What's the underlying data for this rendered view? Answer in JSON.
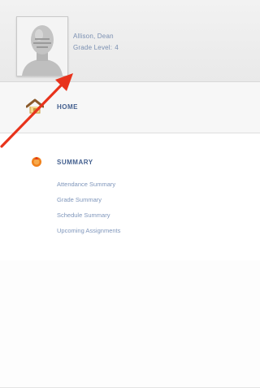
{
  "profile": {
    "name": "Allison, Dean",
    "grade_label": "Grade Level:",
    "grade_value": "4",
    "avatar_icon": "user-silhouette-icon"
  },
  "nav": {
    "home": {
      "label": "HOME",
      "icon": "home-icon"
    },
    "summary": {
      "label": "SUMMARY",
      "icon": "summary-bullet-icon",
      "links": [
        "Attendance Summary",
        "Grade Summary",
        "Schedule Summary",
        "Upcoming Assignments"
      ]
    }
  },
  "annotation": {
    "icon": "red-arrow-icon",
    "color": "#e8331c"
  },
  "colors": {
    "link": "#7f96bb",
    "heading": "#44608f",
    "header_bg": "#eeeeee",
    "home_roof": "#8b5a2b",
    "summary_bullet": "#f0811b"
  }
}
